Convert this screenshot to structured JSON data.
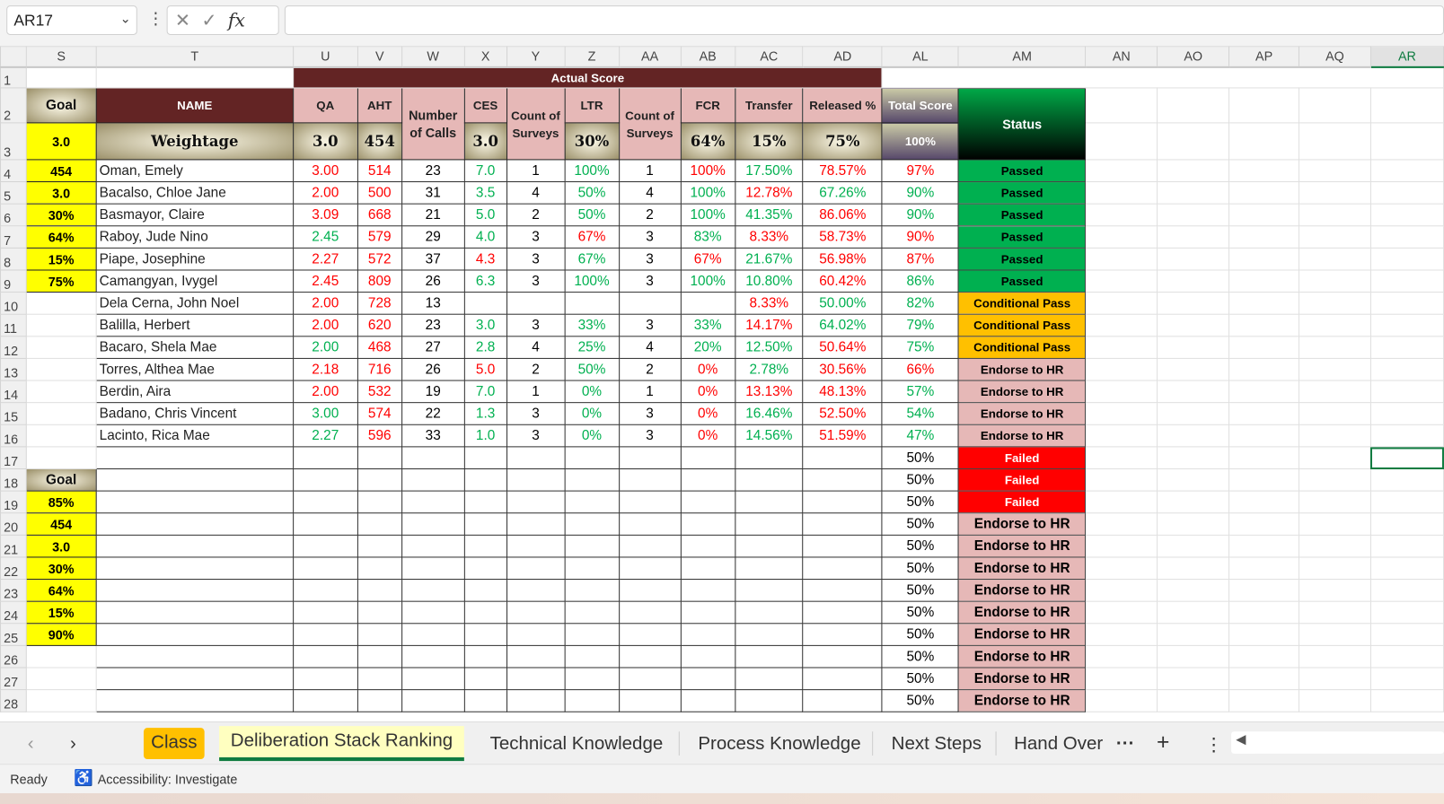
{
  "formula_bar": {
    "name_box": "AR17",
    "formula": ""
  },
  "columns": [
    "S",
    "T",
    "U",
    "V",
    "W",
    "X",
    "Y",
    "Z",
    "AA",
    "AB",
    "AC",
    "AD",
    "AL",
    "AM",
    "AN",
    "AO",
    "AP",
    "AQ",
    "AR"
  ],
  "header": {
    "actual_score": "Actual Score",
    "goal": "Goal",
    "name": "NAME",
    "weightage": "Weightage",
    "qa": "QA",
    "aht": "AHT",
    "calls": "Number of Calls",
    "ces": "CES",
    "count_surveys": "Count of Surveys",
    "ltr": "LTR",
    "count_of_surveys": "Count of Surveys",
    "fcr": "FCR",
    "transfer": "Transfer",
    "released": "Released %",
    "total": "Total Score",
    "status": "Status",
    "w_goal": "3.0",
    "w_qa": "3.0",
    "w_aht": "454",
    "w_ces": "3.0",
    "w_ltr": "30%",
    "w_fcr": "64%",
    "w_transfer": "15%",
    "w_released": "75%",
    "w_total": "100%"
  },
  "goal_top": [
    "454",
    "3.0",
    "30%",
    "64%",
    "15%",
    "75%"
  ],
  "goal_bottom": [
    "Goal",
    "85%",
    "454",
    "3.0",
    "30%",
    "64%",
    "15%",
    "90%"
  ],
  "rows": [
    {
      "name": "Oman, Emely",
      "v": [
        "3.00",
        "514",
        "23",
        "7.0",
        "1",
        "100%",
        "1",
        "100%",
        "17.50%",
        "78.57%",
        "97%"
      ],
      "c": [
        "r",
        "r",
        "",
        "g",
        "",
        "g",
        "",
        "r",
        "g",
        "r",
        "r"
      ],
      "status": "Passed",
      "s": "pass"
    },
    {
      "name": "Bacalso, Chloe Jane",
      "v": [
        "2.00",
        "500",
        "31",
        "3.5",
        "4",
        "50%",
        "4",
        "100%",
        "12.78%",
        "67.26%",
        "90%"
      ],
      "c": [
        "r",
        "r",
        "",
        "g",
        "",
        "g",
        "",
        "g",
        "r",
        "g",
        "g"
      ],
      "status": "Passed",
      "s": "pass"
    },
    {
      "name": "Basmayor, Claire",
      "v": [
        "3.09",
        "668",
        "21",
        "5.0",
        "2",
        "50%",
        "2",
        "100%",
        "41.35%",
        "86.06%",
        "90%"
      ],
      "c": [
        "r",
        "r",
        "",
        "g",
        "",
        "g",
        "",
        "g",
        "g",
        "r",
        "g"
      ],
      "status": "Passed",
      "s": "pass"
    },
    {
      "name": "Raboy, Jude Nino",
      "v": [
        "2.45",
        "579",
        "29",
        "4.0",
        "3",
        "67%",
        "3",
        "83%",
        "8.33%",
        "58.73%",
        "90%"
      ],
      "c": [
        "g",
        "r",
        "",
        "g",
        "",
        "r",
        "",
        "g",
        "r",
        "r",
        "r"
      ],
      "status": "Passed",
      "s": "pass"
    },
    {
      "name": "Piape, Josephine",
      "v": [
        "2.27",
        "572",
        "37",
        "4.3",
        "3",
        "67%",
        "3",
        "67%",
        "21.67%",
        "56.98%",
        "87%"
      ],
      "c": [
        "r",
        "r",
        "",
        "r",
        "",
        "g",
        "",
        "r",
        "g",
        "r",
        "r"
      ],
      "status": "Passed",
      "s": "pass"
    },
    {
      "name": "Camangyan, Ivygel",
      "v": [
        "2.45",
        "809",
        "26",
        "6.3",
        "3",
        "100%",
        "3",
        "100%",
        "10.80%",
        "60.42%",
        "86%"
      ],
      "c": [
        "r",
        "r",
        "",
        "g",
        "",
        "g",
        "",
        "g",
        "g",
        "r",
        "g"
      ],
      "status": "Passed",
      "s": "pass"
    },
    {
      "name": "Dela Cerna, John Noel",
      "v": [
        "2.00",
        "728",
        "13",
        "",
        "",
        "",
        "",
        "",
        "8.33%",
        "50.00%",
        "82%"
      ],
      "c": [
        "r",
        "r",
        "",
        "",
        "",
        "",
        "",
        "",
        "r",
        "g",
        "g"
      ],
      "status": "Conditional Pass",
      "s": "cond"
    },
    {
      "name": "Balilla, Herbert",
      "v": [
        "2.00",
        "620",
        "23",
        "3.0",
        "3",
        "33%",
        "3",
        "33%",
        "14.17%",
        "64.02%",
        "79%"
      ],
      "c": [
        "r",
        "r",
        "",
        "g",
        "",
        "g",
        "",
        "g",
        "r",
        "g",
        "g"
      ],
      "status": "Conditional Pass",
      "s": "cond"
    },
    {
      "name": "Bacaro, Shela Mae",
      "v": [
        "2.00",
        "468",
        "27",
        "2.8",
        "4",
        "25%",
        "4",
        "20%",
        "12.50%",
        "50.64%",
        "75%"
      ],
      "c": [
        "g",
        "r",
        "",
        "g",
        "",
        "g",
        "",
        "g",
        "g",
        "r",
        "g"
      ],
      "status": "Conditional Pass",
      "s": "cond"
    },
    {
      "name": "Torres, Althea Mae",
      "v": [
        "2.18",
        "716",
        "26",
        "5.0",
        "2",
        "50%",
        "2",
        "0%",
        "2.78%",
        "30.56%",
        "66%"
      ],
      "c": [
        "r",
        "r",
        "",
        "r",
        "",
        "g",
        "",
        "r",
        "g",
        "r",
        "r"
      ],
      "status": "Endorse to HR",
      "s": "end"
    },
    {
      "name": "Berdin, Aira",
      "v": [
        "2.00",
        "532",
        "19",
        "7.0",
        "1",
        "0%",
        "1",
        "0%",
        "13.13%",
        "48.13%",
        "57%"
      ],
      "c": [
        "r",
        "r",
        "",
        "g",
        "",
        "g",
        "",
        "r",
        "r",
        "r",
        "g"
      ],
      "status": "Endorse to HR",
      "s": "end"
    },
    {
      "name": "Badano, Chris Vincent",
      "v": [
        "3.00",
        "574",
        "22",
        "1.3",
        "3",
        "0%",
        "3",
        "0%",
        "16.46%",
        "52.50%",
        "54%"
      ],
      "c": [
        "g",
        "r",
        "",
        "g",
        "",
        "g",
        "",
        "r",
        "g",
        "r",
        "g"
      ],
      "status": "Endorse to HR",
      "s": "end"
    },
    {
      "name": "Lacinto, Rica Mae",
      "v": [
        "2.27",
        "596",
        "33",
        "1.0",
        "3",
        "0%",
        "3",
        "0%",
        "14.56%",
        "51.59%",
        "47%"
      ],
      "c": [
        "g",
        "r",
        "",
        "g",
        "",
        "g",
        "",
        "r",
        "g",
        "r",
        "g"
      ],
      "status": "Endorse to HR",
      "s": "end"
    }
  ],
  "empty_rows": [
    {
      "total": "50%",
      "status": "Failed",
      "s": "fail"
    },
    {
      "total": "50%",
      "status": "Failed",
      "s": "fail"
    },
    {
      "total": "50%",
      "status": "Failed",
      "s": "fail"
    },
    {
      "total": "50%",
      "status": "Endorse to HR",
      "s": "end2"
    },
    {
      "total": "50%",
      "status": "Endorse to HR",
      "s": "end2"
    },
    {
      "total": "50%",
      "status": "Endorse to HR",
      "s": "end2"
    },
    {
      "total": "50%",
      "status": "Endorse to HR",
      "s": "end2"
    },
    {
      "total": "50%",
      "status": "Endorse to HR",
      "s": "end2"
    },
    {
      "total": "50%",
      "status": "Endorse to HR",
      "s": "end2"
    },
    {
      "total": "50%",
      "status": "Endorse to HR",
      "s": "end2"
    },
    {
      "total": "50%",
      "status": "Endorse to HR",
      "s": "end2"
    },
    {
      "total": "50%",
      "status": "Endorse to HR",
      "s": "end2"
    }
  ],
  "sheet_tabs": {
    "class": "Class",
    "active": "Deliberation Stack Ranking",
    "t3": "Technical Knowledge",
    "t4": "Process Knowledge",
    "t5": "Next Steps",
    "t6": "Hand Over"
  },
  "status_bar": {
    "ready": "Ready",
    "accessibility": "Accessibility: Investigate"
  }
}
